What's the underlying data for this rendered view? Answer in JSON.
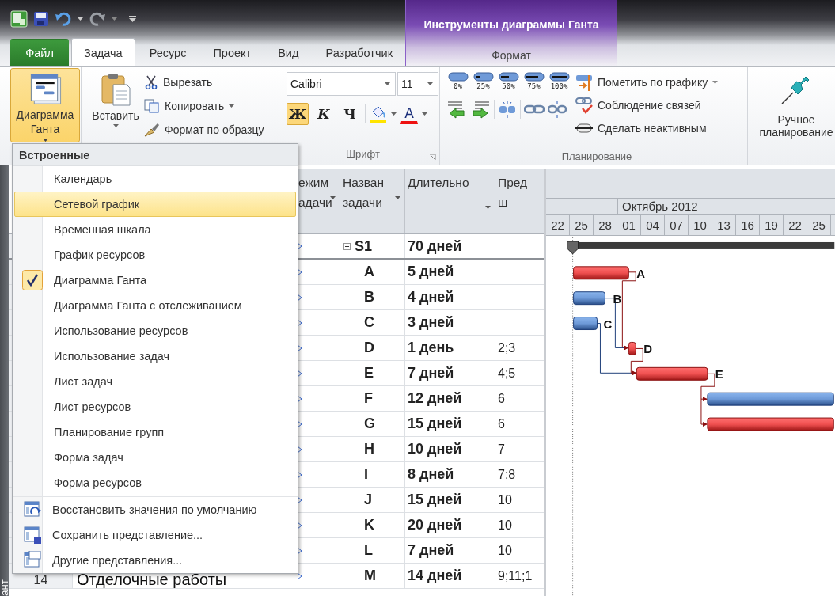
{
  "title_bar": {
    "contextual_title": "Инструменты диаграммы Ганта"
  },
  "tabs": [
    {
      "label": "Файл",
      "kind": "file",
      "selected": false
    },
    {
      "label": "Задача",
      "kind": "tab",
      "selected": true
    },
    {
      "label": "Ресурс",
      "kind": "tab",
      "selected": false
    },
    {
      "label": "Проект",
      "kind": "tab",
      "selected": false
    },
    {
      "label": "Вид",
      "kind": "tab",
      "selected": false
    },
    {
      "label": "Разработчик",
      "kind": "tab",
      "selected": false
    },
    {
      "label": "Формат",
      "kind": "contextual",
      "selected": false
    }
  ],
  "ribbon": {
    "view_button": {
      "label": "Диаграмма Ганта",
      "open": true
    },
    "clipboard": {
      "paste": "Вставить",
      "cut": "Вырезать",
      "copy": "Копировать",
      "format_painter": "Формат по образцу"
    },
    "font": {
      "group": "Шрифт",
      "family": "Calibri",
      "size": "11",
      "bold_label": "Ж",
      "italic_label": "К",
      "underline_label": "Ч",
      "color_label": "A",
      "bold": true
    },
    "schedule": {
      "group": "Планирование",
      "percents": [
        "0%",
        "25%",
        "50%",
        "75%",
        "100%"
      ],
      "mark_on_track": "Пометить по графику",
      "respect_links": "Соблюдение связей",
      "inactivate": "Сделать неактивным"
    },
    "manual": {
      "label": "Ручное планирование"
    }
  },
  "views_menu": {
    "heading": "Встроенные",
    "items": [
      {
        "label": "Календарь",
        "selected": false,
        "checked": false
      },
      {
        "label": "Сетевой график",
        "selected": true,
        "checked": false
      },
      {
        "label": "Временная шкала",
        "selected": false,
        "checked": false
      },
      {
        "label": "График ресурсов",
        "selected": false,
        "checked": false
      },
      {
        "label": "Диаграмма Ганта",
        "selected": false,
        "checked": true
      },
      {
        "label": "Диаграмма Ганта с отслеживанием",
        "selected": false,
        "checked": false
      },
      {
        "label": "Использование ресурсов",
        "selected": false,
        "checked": false
      },
      {
        "label": "Использование задач",
        "selected": false,
        "checked": false
      },
      {
        "label": "Лист задач",
        "selected": false,
        "checked": false
      },
      {
        "label": "Лист ресурсов",
        "selected": false,
        "checked": false
      },
      {
        "label": "Планирование групп",
        "selected": false,
        "checked": false
      },
      {
        "label": "Форма задач",
        "selected": false,
        "checked": false
      },
      {
        "label": "Форма ресурсов",
        "selected": false,
        "checked": false
      }
    ],
    "actions": [
      {
        "label": "Восстановить значения по умолчанию",
        "kind": "reset"
      },
      {
        "label": "Сохранить представление...",
        "kind": "save"
      },
      {
        "label": "Другие представления...",
        "kind": "more"
      }
    ]
  },
  "side_label": "ант",
  "table": {
    "columns": [
      "ежим адачи",
      "Назван задачи",
      "Длительно",
      "Предш"
    ],
    "rows": [
      {
        "kind": "summary",
        "expanded": true,
        "name": "S1",
        "duration": "70 дней"
      },
      {
        "kind": "task",
        "name": "A",
        "duration": "5 дней"
      },
      {
        "kind": "task",
        "name": "B",
        "duration": "4 дней"
      },
      {
        "kind": "task",
        "name": "C",
        "duration": "3 дней"
      },
      {
        "kind": "task",
        "name": "D",
        "duration": "1 день",
        "predecessors": "2;3"
      },
      {
        "kind": "task",
        "name": "E",
        "duration": "7 дней",
        "predecessors": "4;5"
      },
      {
        "kind": "task",
        "name": "F",
        "duration": "12 дней",
        "predecessors": "6"
      },
      {
        "kind": "task",
        "name": "G",
        "duration": "15 дней",
        "predecessors": "6"
      },
      {
        "kind": "task",
        "name": "H",
        "duration": "10 дней",
        "predecessors": "7"
      },
      {
        "kind": "task",
        "name": "I",
        "duration": "8 дней",
        "predecessors": "7;8"
      },
      {
        "kind": "task",
        "name": "J",
        "duration": "15 дней",
        "predecessors": "10"
      },
      {
        "kind": "task",
        "name": "K",
        "duration": "20 дней",
        "predecessors": "10"
      },
      {
        "kind": "task",
        "name": "L",
        "duration": "7 дней",
        "predecessors": "10"
      },
      {
        "kind": "task",
        "id": "14",
        "title": "Отделочные работы",
        "name": "M",
        "duration": "14 дней",
        "predecessors": "9;11;1"
      }
    ]
  },
  "gantt": {
    "month": "Октябрь 2012",
    "days": [
      "22",
      "25",
      "28",
      "01",
      "04",
      "07",
      "10",
      "13",
      "16",
      "19",
      "22",
      "25"
    ],
    "bars": [
      {
        "label": "A",
        "critical": true
      },
      {
        "label": "B",
        "critical": false
      },
      {
        "label": "C",
        "critical": false
      },
      {
        "label": "D",
        "critical": true
      },
      {
        "label": "E",
        "critical": true
      },
      {
        "critical": false
      },
      {
        "critical": true
      }
    ]
  }
}
